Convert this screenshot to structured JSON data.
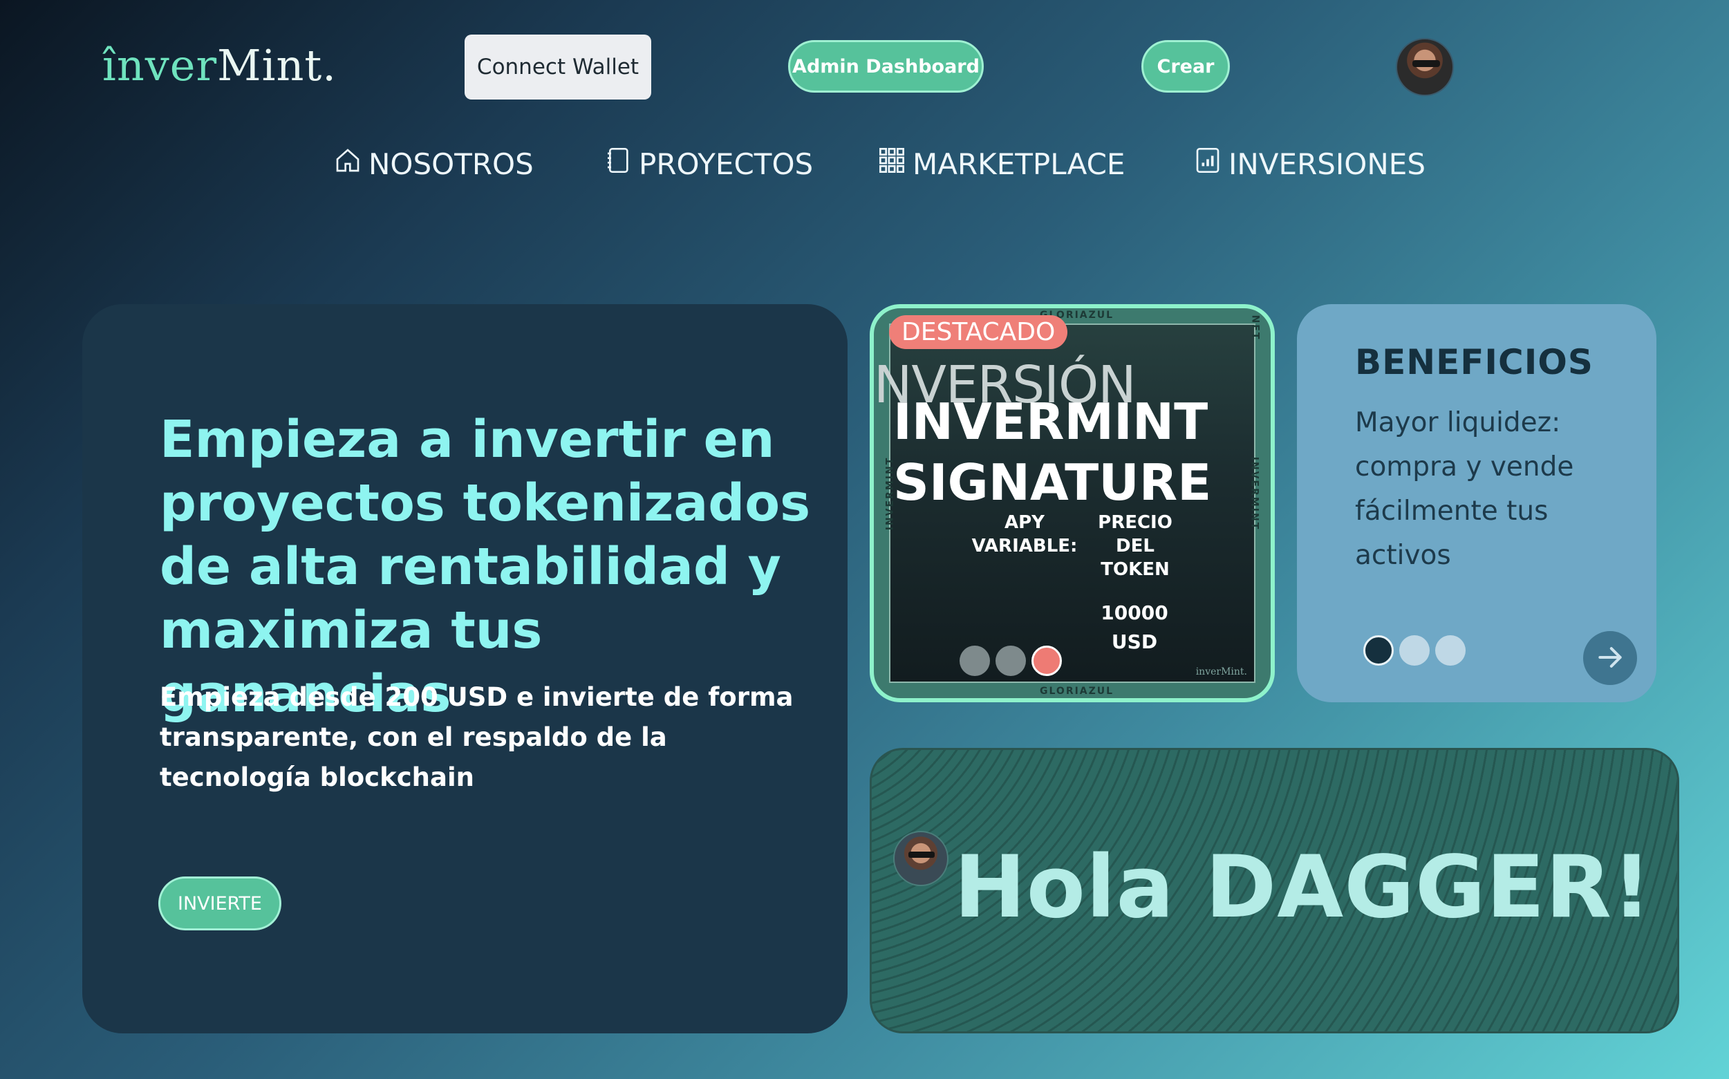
{
  "header": {
    "logo_accent": "înver",
    "logo_rest": "Mint.",
    "connect_wallet": "Connect Wallet",
    "admin_dashboard": "Admin Dashboard",
    "crear": "Crear"
  },
  "nav": [
    {
      "label": "NOSOTROS",
      "icon": "home-icon"
    },
    {
      "label": "PROYECTOS",
      "icon": "notebook-icon"
    },
    {
      "label": "MARKETPLACE",
      "icon": "grid-icon"
    },
    {
      "label": "INVERSIONES",
      "icon": "bar-chart-icon"
    }
  ],
  "hero": {
    "title": "Empieza a invertir en proyectos tokenizados de alta rentabilidad y maximiza tus ganancias",
    "subtitle": "Empieza desde 200 USD e invierte de forma transparente, con el respaldo de la tecnología blockchain",
    "cta": "INVIERTE"
  },
  "featured": {
    "badge": "DESTACADO",
    "ghost_text": "NVERSIÓN",
    "title_line1": "INVERMINT",
    "title_line2": "SIGNATURE",
    "apy_label": "APY VARIABLE:",
    "price_label": "PRECIO DEL TOKEN",
    "price_value": "10000",
    "price_unit": "USD",
    "frame_top": "GLORIAZUL",
    "frame_bottom": "GLORIAZUL",
    "frame_side": "INVERMINT",
    "frame_corner": "NFT",
    "brand_mini": "inverMint.",
    "active_slide": 3,
    "total_slides": 3
  },
  "benefits": {
    "title": "BENEFICIOS",
    "text": "Mayor liquidez: compra y vende fácilmente tus activos",
    "active_slide": 1,
    "total_slides": 3
  },
  "greeting": {
    "text": "Hola DAGGER!"
  },
  "colors": {
    "accent": "#56c29b",
    "hero_title": "#8ef4f0",
    "badge": "#ef7f78",
    "benefits_bg": "#6fa8c6"
  }
}
